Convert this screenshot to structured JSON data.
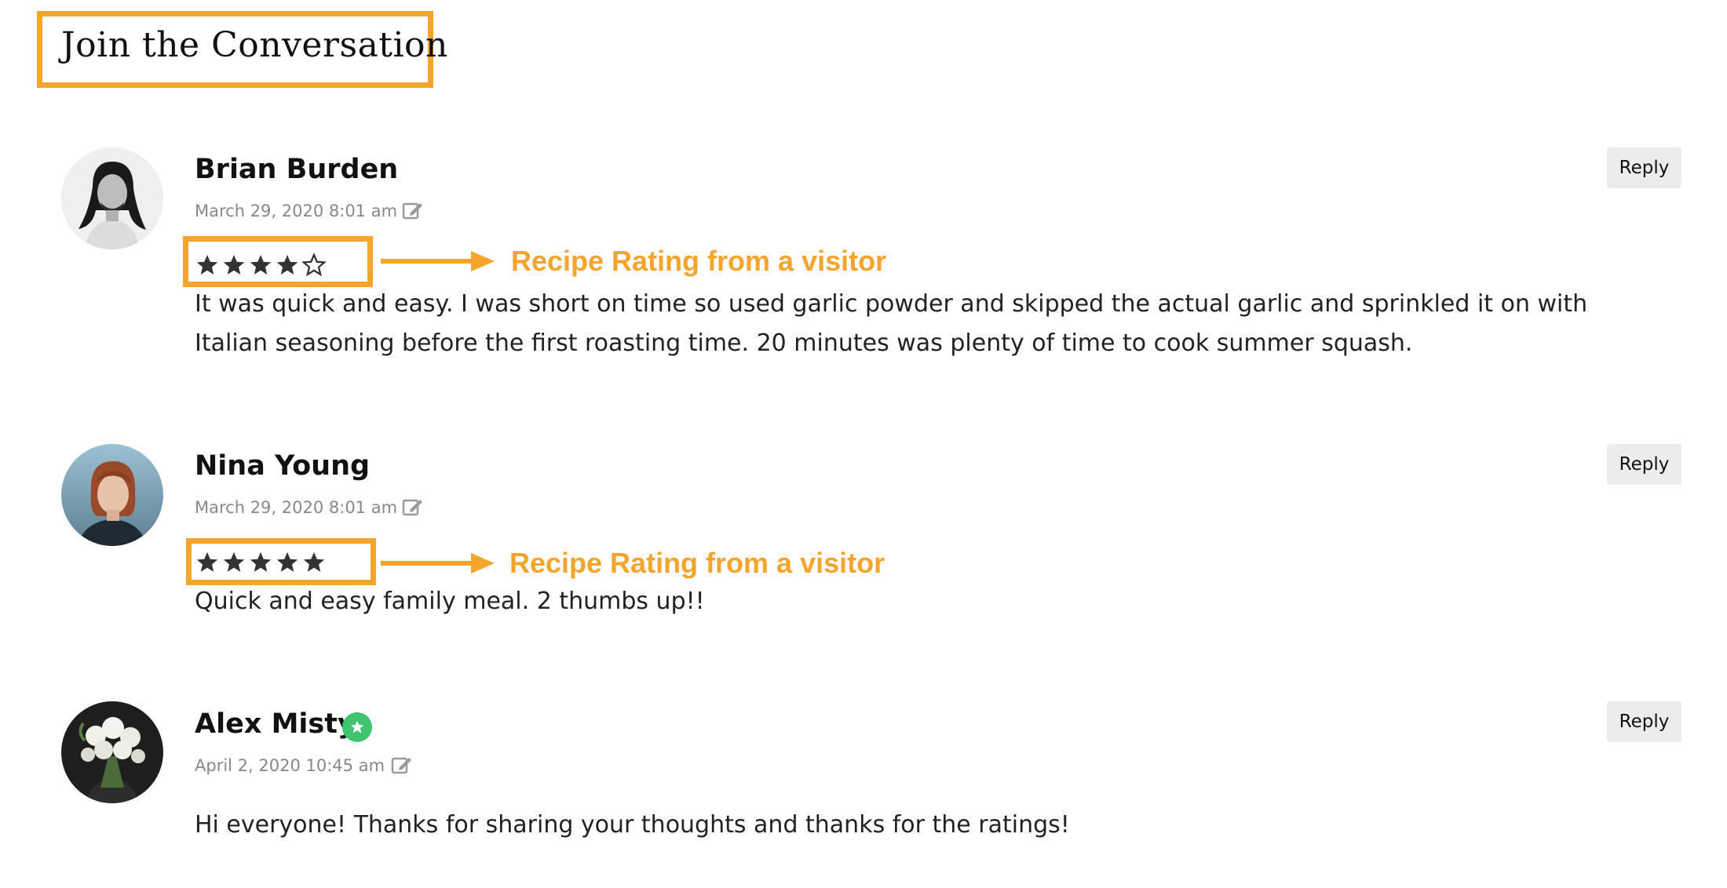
{
  "header": {
    "title": "Join the Conversation"
  },
  "colors": {
    "accent": "#F5A42C",
    "star": "#333333",
    "verified": "#3fc46f"
  },
  "comments": [
    {
      "author": "Brian Burden",
      "date": "March 29, 2020 8:01 am",
      "rating": 4,
      "rating_max": 5,
      "annotation": "Recipe Rating from a visitor",
      "text": "It was quick and easy. I was short on time so used garlic powder and skipped the actual garlic and sprinkled it on with Italian seasoning before the first roasting time. 20 minutes was plenty of time to cook summer squash.",
      "reply_label": "Reply",
      "icons": {
        "avatar": "man-long-hair-portrait",
        "edit": "edit-icon"
      }
    },
    {
      "author": "Nina Young",
      "date": "March 29, 2020 8:01 am",
      "rating": 5,
      "rating_max": 5,
      "annotation": "Recipe Rating from a visitor",
      "text": "Quick and easy family meal. 2 thumbs up!!",
      "reply_label": "Reply",
      "icons": {
        "avatar": "woman-red-hair-portrait",
        "edit": "edit-icon"
      }
    },
    {
      "author": "Alex Misty",
      "date": "April 2, 2020 10:45 am",
      "verified": true,
      "text": "Hi everyone! Thanks for sharing your thoughts and thanks for the ratings!",
      "reply_label": "Reply",
      "icons": {
        "avatar": "flower-bouquet-portrait",
        "edit": "edit-icon",
        "badge": "star-badge-icon"
      }
    }
  ]
}
